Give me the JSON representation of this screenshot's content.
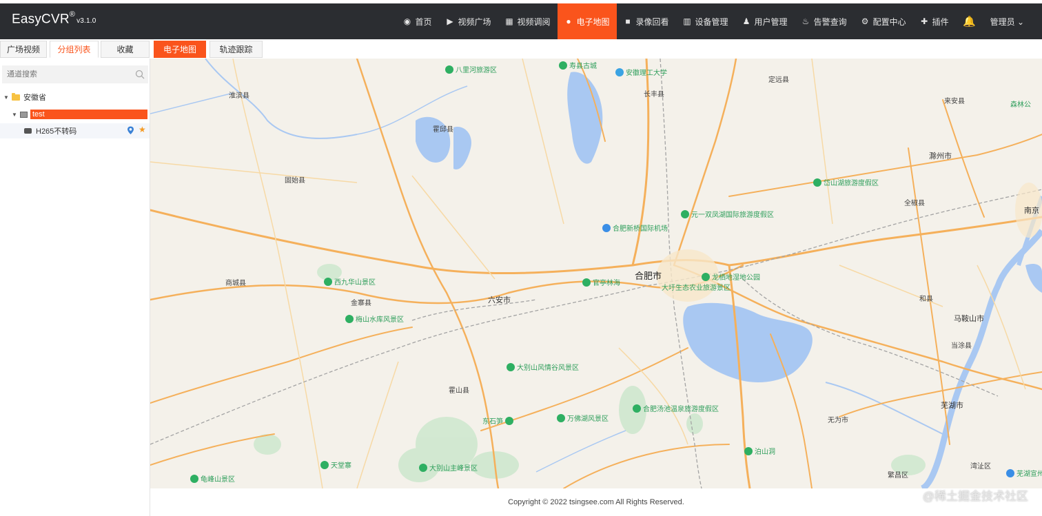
{
  "app": {
    "brand": "EasyCVR",
    "reg": "®",
    "version": "v3.1.0"
  },
  "nav": {
    "items": [
      {
        "label": "首页",
        "icon": "dashboard-icon"
      },
      {
        "label": "视频广场",
        "icon": "play-icon"
      },
      {
        "label": "视频调阅",
        "icon": "grid-icon"
      },
      {
        "label": "电子地图",
        "icon": "location-icon",
        "active": true
      },
      {
        "label": "录像回看",
        "icon": "video-camera-icon"
      },
      {
        "label": "设备管理",
        "icon": "device-icon"
      },
      {
        "label": "用户管理",
        "icon": "user-icon"
      },
      {
        "label": "告警查询",
        "icon": "alarm-icon"
      },
      {
        "label": "配置中心",
        "icon": "gear-icon"
      },
      {
        "label": "插件",
        "icon": "puzzle-icon"
      }
    ],
    "bell_icon": "bell-icon",
    "user": "管理员 ⌄"
  },
  "tabs": {
    "plaza": "广场视频",
    "group": "分组列表",
    "fav": "收藏",
    "map": "电子地图",
    "track": "轨迹跟踪"
  },
  "sidebar": {
    "search_placeholder": "通道搜索",
    "root": "安徽省",
    "group": "test",
    "device": "H265不转码"
  },
  "map": {
    "labels": {
      "hefei": "合肥市",
      "luan": "六安市",
      "chuzhou": "滁州市",
      "maanshan": "马鞍山市",
      "wuhu": "芜湖市",
      "nanjing": "南京",
      "changfeng": "长丰县",
      "dingyuan": "定远县",
      "laian": "来安县",
      "quanjiao": "全椒县",
      "hexian": "和县",
      "dangtu": "当涂县",
      "wuwei": "无为市",
      "huoqiu": "霍邱县",
      "gushi": "固始县",
      "huaibin": "淮滨县",
      "shangcheng": "商城县",
      "jinzhai": "金寨县",
      "huoshan": "霍山县",
      "fanchang": "繁昌区",
      "wanzhi": "湾沚区",
      "feidong_a": "定远县"
    },
    "pois": {
      "bali": "八里河旅游区",
      "shouxian": "寿县古城",
      "anhui_univ": "安徽理工大学",
      "xijiuhua": "西九华山景区",
      "meishan": "梅山水库风景区",
      "guanting": "官亭林海",
      "dabie_valley": "大别山风情谷风景区",
      "wanfo": "万佛湖风景区",
      "tangchi": "合肥汤池温泉旅游度假区",
      "dongshi": "东石笋",
      "tiantang": "天堂寨",
      "dabie_main": "大别山主峰景区",
      "guitou": "龟峰山景区",
      "yuanyi": "元一双凤湖国际旅游度假区",
      "hefei_airport": "合肥新桥国际机场",
      "luochi": "大圩生态农业旅游景区",
      "lugang": "龙栖地湿地公园",
      "daishan": "岱山湖旅游度假区",
      "senlin": "森林公",
      "zhongshan": "泊山洞",
      "wuhu_airport": "芜湖宣州"
    }
  },
  "footer": {
    "copyright": "Copyright © 2022 tsingsee.com All Rights Reserved."
  },
  "watermark": "@稀土掘金技术社区",
  "colors": {
    "accent": "#fa541c",
    "navbar": "#2b2d31",
    "water": "#a9c8f2",
    "road": "#f5b05b"
  }
}
